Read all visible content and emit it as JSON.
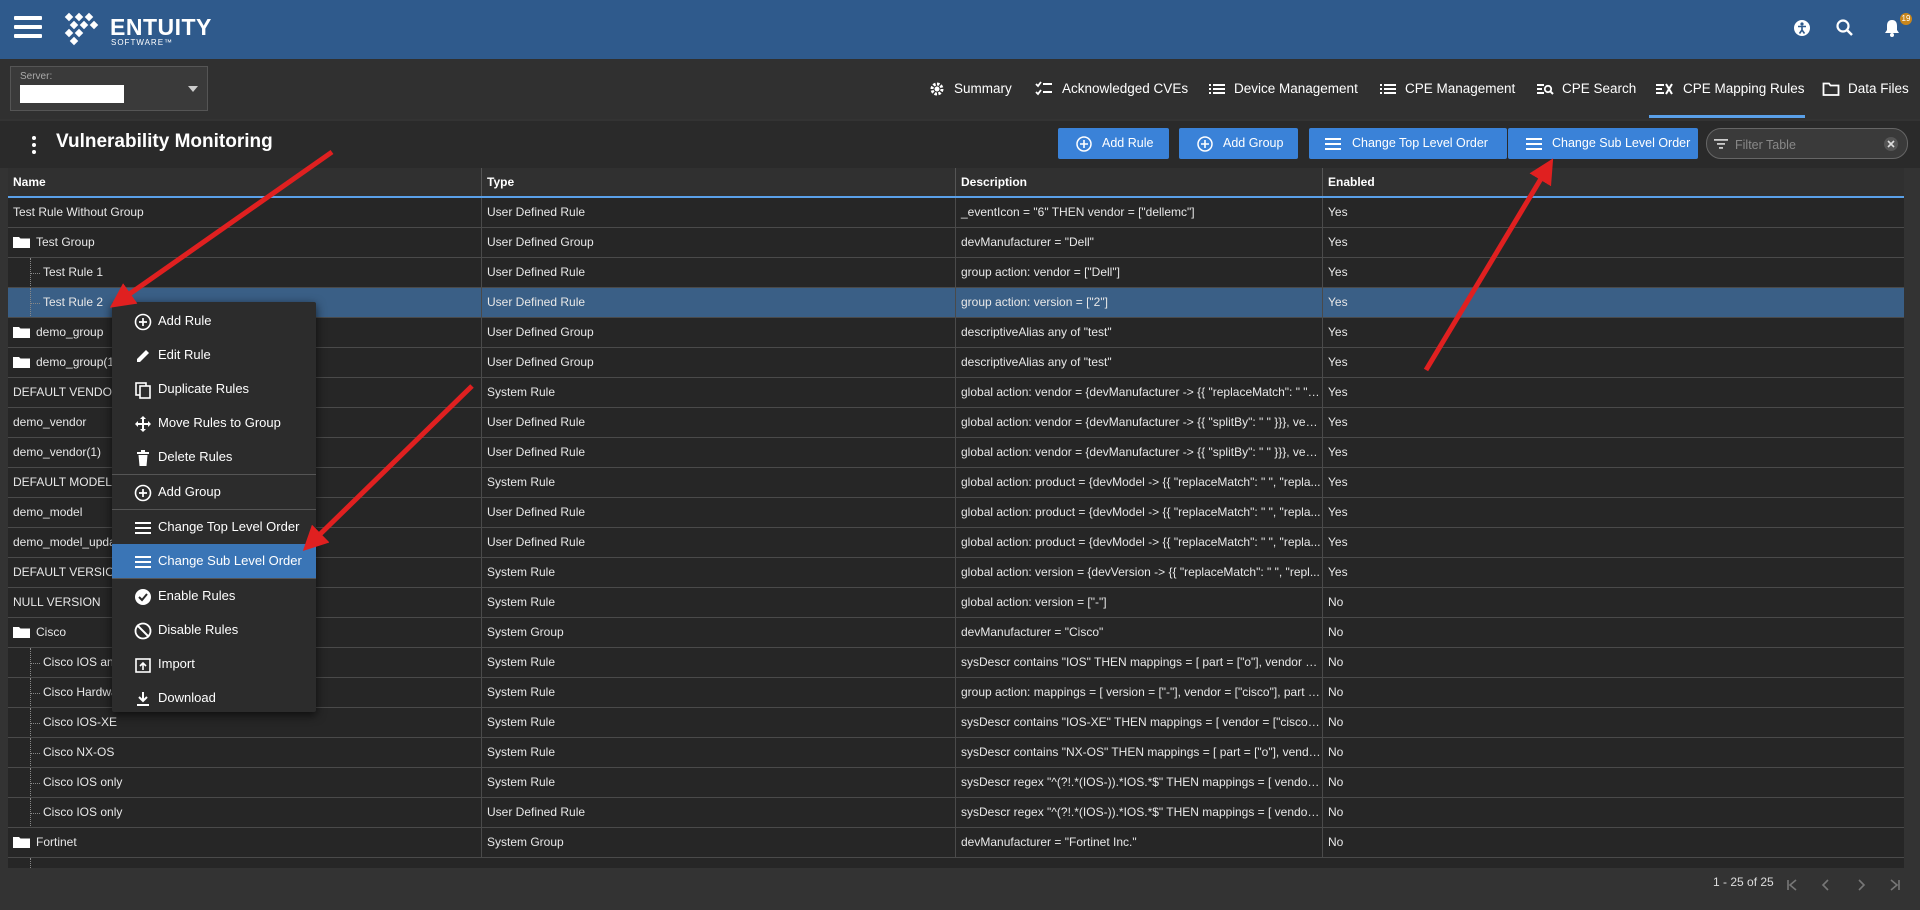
{
  "app": {
    "logo_name": "ENTUITY",
    "logo_sub": "SOFTWARE™",
    "notifications_count": "19"
  },
  "server": {
    "label": "Server:",
    "value": ""
  },
  "nav": {
    "tabs": [
      {
        "label": "Summary",
        "icon": "gear-icon"
      },
      {
        "label": "Acknowledged CVEs",
        "icon": "checklist-icon"
      },
      {
        "label": "Device Management",
        "icon": "list-icon"
      },
      {
        "label": "CPE Management",
        "icon": "list-icon"
      },
      {
        "label": "CPE Search",
        "icon": "search-list-icon"
      },
      {
        "label": "CPE Mapping Rules",
        "icon": "mapping-icon",
        "active": true
      },
      {
        "label": "Data Files",
        "icon": "folder-icon"
      }
    ]
  },
  "page": {
    "title": "Vulnerability Monitoring"
  },
  "toolbar": {
    "add_rule": "Add Rule",
    "add_group": "Add Group",
    "change_top_level": "Change Top Level Order",
    "change_sub_level": "Change Sub Level Order",
    "filter_placeholder": "Filter Table"
  },
  "table": {
    "columns": [
      "Name",
      "Type",
      "Description",
      "Enabled"
    ],
    "rows": [
      {
        "name": "Test Rule Without Group",
        "type": "User Defined Rule",
        "description": "_eventIcon = \"6\" THEN vendor = [\"dellemc\"]",
        "enabled": "Yes"
      },
      {
        "name": "Test Group",
        "type": "User Defined Group",
        "description": "devManufacturer = \"Dell\"",
        "enabled": "Yes"
      },
      {
        "name": "Test Rule 1",
        "type": "User Defined Rule",
        "description": "group action: vendor = [\"Dell\"]",
        "enabled": "Yes"
      },
      {
        "name": "Test Rule 2",
        "type": "User Defined Rule",
        "description": "group action: version = [\"2\"]",
        "enabled": "Yes"
      },
      {
        "name": "demo_group",
        "type": "User Defined Group",
        "description": "descriptiveAlias any of \"test\"",
        "enabled": "Yes"
      },
      {
        "name": "demo_group(1)",
        "type": "User Defined Group",
        "description": "descriptiveAlias any of \"test\"",
        "enabled": "Yes"
      },
      {
        "name": "DEFAULT VENDOR",
        "type": "System Rule",
        "description": "global action: vendor = {devManufacturer -> {{ \"replaceMatch\": \" \", ...",
        "enabled": "Yes"
      },
      {
        "name": "demo_vendor",
        "type": "User Defined Rule",
        "description": "global action: vendor = {devManufacturer -> {{ \"splitBy\": \" \" }}}, ven...",
        "enabled": "Yes"
      },
      {
        "name": "demo_vendor(1)",
        "type": "User Defined Rule",
        "description": "global action: vendor = {devManufacturer -> {{ \"splitBy\": \" \" }}}, ven...",
        "enabled": "Yes"
      },
      {
        "name": "DEFAULT MODEL",
        "type": "System Rule",
        "description": "global action: product = {devModel -> {{ \"replaceMatch\": \" \", \"repla...",
        "enabled": "Yes"
      },
      {
        "name": "demo_model",
        "type": "User Defined Rule",
        "description": "global action: product = {devModel -> {{ \"replaceMatch\": \" \", \"repla...",
        "enabled": "Yes"
      },
      {
        "name": "demo_model_upda",
        "type": "User Defined Rule",
        "description": "global action: product = {devModel -> {{ \"replaceMatch\": \" \", \"repla...",
        "enabled": "Yes"
      },
      {
        "name": "DEFAULT VERSION",
        "type": "System Rule",
        "description": "global action: version = {devVersion -> {{ \"replaceMatch\": \" \", \"repl...",
        "enabled": "Yes"
      },
      {
        "name": "NULL VERSION",
        "type": "System Rule",
        "description": "global action: version = [\"-\"]",
        "enabled": "No"
      },
      {
        "name": "Cisco",
        "type": "System Group",
        "description": "devManufacturer = \"Cisco\"",
        "enabled": "No"
      },
      {
        "name": "Cisco IOS anc",
        "type": "System Rule",
        "description": "sysDescr contains \"IOS\" THEN mappings = [ part = [\"o\"], vendor = [...",
        "enabled": "No"
      },
      {
        "name": "Cisco Hardwa",
        "type": "System Rule",
        "description": "group action: mappings = [ version = [\"-\"], vendor = [\"cisco\"], part =...",
        "enabled": "No"
      },
      {
        "name": "Cisco IOS-XE",
        "type": "System Rule",
        "description": "sysDescr contains \"IOS-XE\" THEN mappings = [ vendor = [\"cisco\"],...",
        "enabled": "No"
      },
      {
        "name": "Cisco NX-OS",
        "type": "System Rule",
        "description": "sysDescr contains \"NX-OS\" THEN mappings = [ part = [\"o\"], vendor...",
        "enabled": "No"
      },
      {
        "name": "Cisco IOS only",
        "type": "System Rule",
        "description": "sysDescr regex \"^(?!.*(IOS-)).*IOS.*$\" THEN mappings = [ vendor ...",
        "enabled": "No"
      },
      {
        "name": "Cisco IOS only",
        "type": "User Defined Rule",
        "description": "sysDescr regex \"^(?!.*(IOS-)).*IOS.*$\" THEN mappings = [ vendor ...",
        "enabled": "No"
      },
      {
        "name": "Fortinet",
        "type": "System Group",
        "description": "devManufacturer = \"Fortinet Inc.\"",
        "enabled": "No"
      }
    ]
  },
  "pager": {
    "text": "1 - 25 of 25"
  },
  "context_menu": {
    "items": [
      {
        "label": "Add Rule",
        "icon": "add-circle-icon"
      },
      {
        "label": "Edit Rule",
        "icon": "pencil-icon"
      },
      {
        "label": "Duplicate Rules",
        "icon": "copy-icon"
      },
      {
        "label": "Move Rules to Group",
        "icon": "move-icon"
      },
      {
        "label": "Delete Rules",
        "icon": "trash-icon"
      },
      {
        "label": "Add Group",
        "icon": "add-circle-icon"
      },
      {
        "label": "Change Top Level Order",
        "icon": "list-icon"
      },
      {
        "label": "Change Sub Level Order",
        "icon": "list-icon",
        "active": true
      },
      {
        "label": "Enable Rules",
        "icon": "check-circle-icon"
      },
      {
        "label": "Disable Rules",
        "icon": "disabled-icon"
      },
      {
        "label": "Import",
        "icon": "import-icon"
      },
      {
        "label": "Download",
        "icon": "download-icon"
      }
    ]
  },
  "colors": {
    "topbar": "#2f5a8c",
    "accent": "#3a82d8",
    "selected_row": "#3a5f86",
    "annotation_arrow": "#e02020"
  }
}
